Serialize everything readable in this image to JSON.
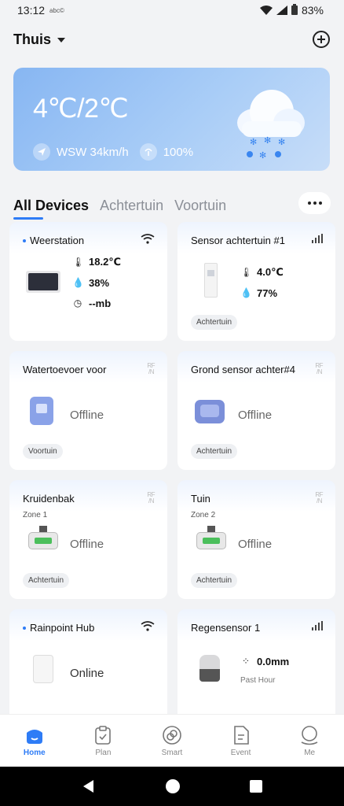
{
  "status_bar": {
    "time": "13:12",
    "extra": "abc©",
    "battery": "83%"
  },
  "header": {
    "home_name": "Thuis"
  },
  "weather": {
    "temperature": "4℃/2℃",
    "wind": "WSW 34km/h",
    "humidity": "100%"
  },
  "tabs": [
    {
      "label": "All Devices",
      "active": true
    },
    {
      "label": "Achtertuin",
      "active": false
    },
    {
      "label": "Voortuin",
      "active": false
    }
  ],
  "devices": [
    {
      "name": "Weerstation",
      "readings": [
        "18.2℃",
        "38%",
        "--mb"
      ]
    },
    {
      "name": "Sensor achtertuin #1",
      "readings": [
        "4.0℃",
        "77%"
      ],
      "tag": "Achtertuin"
    },
    {
      "name": "Watertoevoer voor",
      "status": "Offline",
      "tag": "Voortuin"
    },
    {
      "name": "Grond sensor achter#4",
      "status": "Offline",
      "tag": "Achtertuin"
    },
    {
      "name": "Kruidenbak",
      "zone": "Zone 1",
      "status": "Offline",
      "tag": "Achtertuin"
    },
    {
      "name": "Tuin",
      "zone": "Zone 2",
      "status": "Offline",
      "tag": "Achtertuin"
    },
    {
      "name": "Rainpoint Hub",
      "status": "Online"
    },
    {
      "name": "Regensensor 1",
      "readings": [
        "0.0mm"
      ],
      "sub": "Past Hour"
    }
  ],
  "bottom_nav": [
    {
      "label": "Home",
      "active": true
    },
    {
      "label": "Plan",
      "active": false
    },
    {
      "label": "Smart",
      "active": false
    },
    {
      "label": "Event",
      "active": false
    },
    {
      "label": "Me",
      "active": false
    }
  ],
  "colors": {
    "accent": "#2e7cf6",
    "background": "#f2f3f5",
    "card": "#ffffff"
  }
}
